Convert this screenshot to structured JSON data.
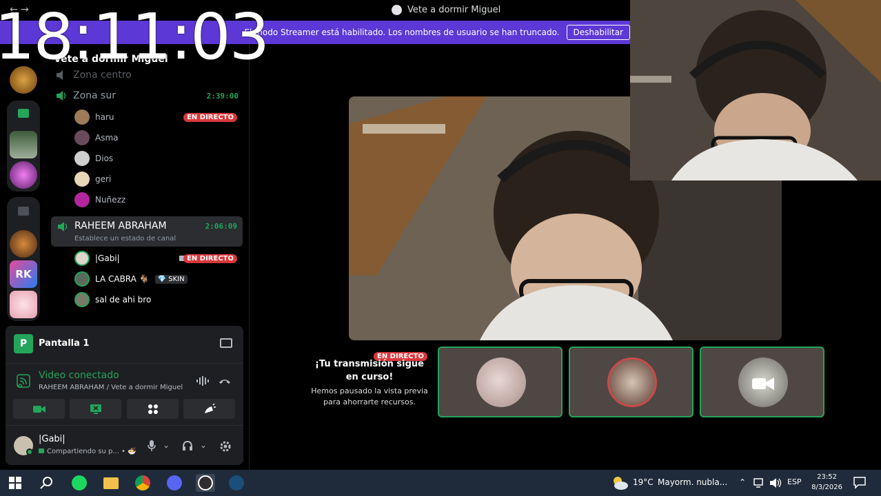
{
  "window": {
    "title": "Vete a dormir Miguel",
    "nav": "← →"
  },
  "overlay_clock": "18:11:03",
  "streamer_banner": {
    "message": "El modo Streamer está habilitado. Los nombres de usuario se han truncado.",
    "button": "Deshabilitar"
  },
  "server": {
    "name": "Vete a dormir Miguel",
    "channels": [
      {
        "name": "Zona centro"
      },
      {
        "name": "Zona sur",
        "timer": "2:39:00",
        "users": [
          {
            "name": "haru",
            "badge": "EN DIRECTO"
          },
          {
            "name": "Asma"
          },
          {
            "name": "Dios"
          },
          {
            "name": "geri"
          },
          {
            "name": "Nuñezz"
          }
        ]
      },
      {
        "name": "RAHEEM ABRAHAM",
        "timer": "2:06:09",
        "status": "Establece un estado de canal",
        "users": [
          {
            "name": "|Gabi|",
            "badge": "EN DIRECTO"
          },
          {
            "name": "LA CABRA 🐐",
            "tag": "💎 SKIN"
          },
          {
            "name": "sal de ahi bro"
          }
        ]
      }
    ]
  },
  "stream_panel": {
    "icon_letter": "P",
    "title": "Pantalla 1",
    "connection": "Video conectado",
    "location": "RAHEEM ABRAHAM / Vete a dormir Miguel"
  },
  "user": {
    "name": "|Gabi|",
    "status": "Compartiendo su p... • 🍜"
  },
  "paused": {
    "badge": "EN DIRECTO",
    "title": "¡Tu transmisión sigue en curso!",
    "subtitle": "Hemos pausado la vista previa para ahorrarte recursos."
  },
  "taskbar": {
    "weather": "19°C",
    "weather_desc": "Mayorm. nubla...",
    "lang": "ESP",
    "time": "23:52",
    "date": "8/3/2026"
  },
  "colors": {
    "banner": "#5c38d6",
    "green": "#23a55a",
    "live_red": "#da373c"
  }
}
